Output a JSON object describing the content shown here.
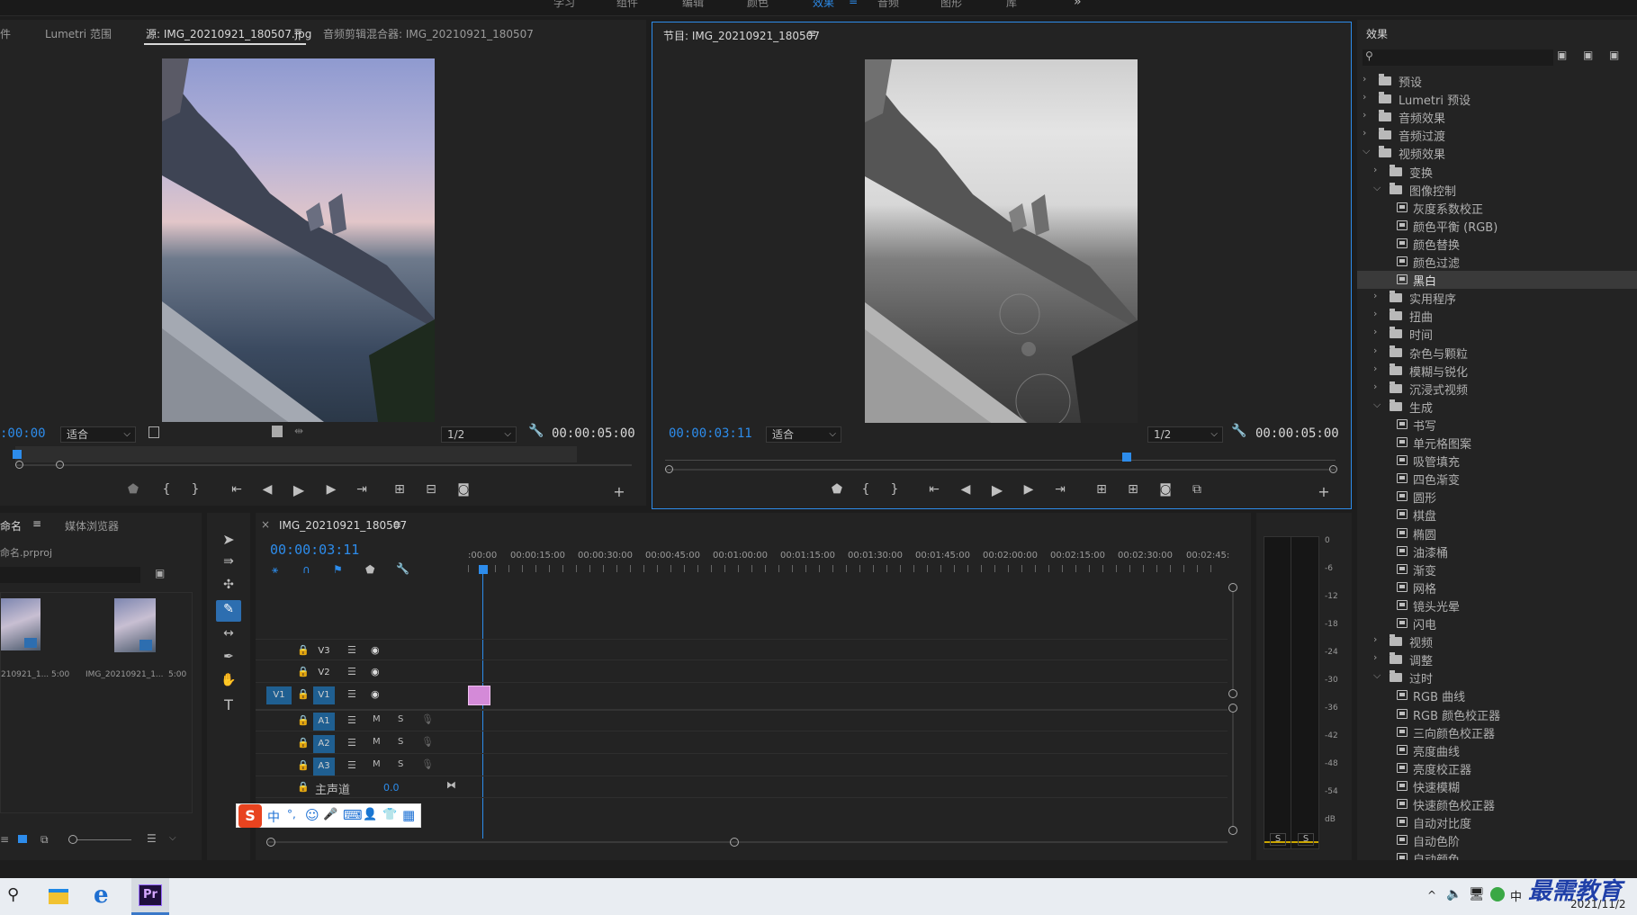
{
  "top_menu": {
    "items": [
      "学习",
      "组件",
      "编辑",
      "颜色",
      "效果",
      "音频",
      "图形",
      "库"
    ],
    "more": "»"
  },
  "source_panel": {
    "tabs": [
      "件",
      "Lumetri 范围",
      "源: IMG_20210921_180507.jpg",
      "音频剪辑混合器: IMG_20210921_180507"
    ],
    "tab_menu_icon": "≡",
    "timecode_left": ":00:00",
    "fit_label": "适合",
    "resolution": "1/2",
    "duration": "00:00:05:00"
  },
  "program_panel": {
    "tab": "节目: IMG_20210921_180507",
    "tab_menu_icon": "≡",
    "timecode_left": "00:00:03:11",
    "fit_label": "适合",
    "resolution": "1/2",
    "duration": "00:00:05:00"
  },
  "project_panel": {
    "tabs": [
      "命名",
      "媒体浏览器"
    ],
    "tab_menu_icon": "≡",
    "project_file": "命名.prproj",
    "items": [
      {
        "name": "210921_1...",
        "duration": "5:00"
      },
      {
        "name": "IMG_20210921_1...",
        "duration": "5:00"
      }
    ]
  },
  "timeline": {
    "close": "×",
    "sequence_name": "IMG_20210921_180507",
    "menu_icon": "≡",
    "timecode": "00:00:03:11",
    "ruler_labels": [
      ":00:00",
      "00:00:15:00",
      "00:00:30:00",
      "00:00:45:00",
      "00:01:00:00",
      "00:01:15:00",
      "00:01:30:00",
      "00:01:45:00",
      "00:02:00:00",
      "00:02:15:00",
      "00:02:30:00",
      "00:02:45:"
    ],
    "video_tracks": [
      "V3",
      "V2",
      "V1"
    ],
    "source_patch": "V1",
    "audio_tracks": [
      "A1",
      "A2",
      "A3"
    ],
    "mute_label": "M",
    "solo_label": "S",
    "master_label": "主声道",
    "master_value": "0.0"
  },
  "audio_meter": {
    "scale": [
      "0",
      "-6",
      "-12",
      "-18",
      "-24",
      "-30",
      "-36",
      "-42",
      "-48",
      "-54",
      "dB"
    ],
    "solo_buttons": [
      "S",
      "S"
    ]
  },
  "effects_panel": {
    "title": "效果",
    "search_placeholder": "",
    "tree": [
      {
        "level": 0,
        "type": "folder",
        "open": false,
        "label": "预设"
      },
      {
        "level": 0,
        "type": "folder",
        "open": false,
        "label": "Lumetri 预设"
      },
      {
        "level": 0,
        "type": "folder",
        "open": false,
        "label": "音频效果"
      },
      {
        "level": 0,
        "type": "folder",
        "open": false,
        "label": "音频过渡"
      },
      {
        "level": 0,
        "type": "folder",
        "open": true,
        "label": "视频效果"
      },
      {
        "level": 1,
        "type": "folder",
        "open": false,
        "label": "变换"
      },
      {
        "level": 1,
        "type": "folder",
        "open": true,
        "label": "图像控制"
      },
      {
        "level": 2,
        "type": "fx",
        "label": "灰度系数校正"
      },
      {
        "level": 2,
        "type": "fx",
        "label": "颜色平衡 (RGB)"
      },
      {
        "level": 2,
        "type": "fx",
        "label": "颜色替换"
      },
      {
        "level": 2,
        "type": "fx",
        "label": "颜色过滤"
      },
      {
        "level": 2,
        "type": "fx",
        "label": "黑白",
        "selected": true
      },
      {
        "level": 1,
        "type": "folder",
        "open": false,
        "label": "实用程序"
      },
      {
        "level": 1,
        "type": "folder",
        "open": false,
        "label": "扭曲"
      },
      {
        "level": 1,
        "type": "folder",
        "open": false,
        "label": "时间"
      },
      {
        "level": 1,
        "type": "folder",
        "open": false,
        "label": "杂色与颗粒"
      },
      {
        "level": 1,
        "type": "folder",
        "open": false,
        "label": "模糊与锐化"
      },
      {
        "level": 1,
        "type": "folder",
        "open": false,
        "label": "沉浸式视频"
      },
      {
        "level": 1,
        "type": "folder",
        "open": true,
        "label": "生成"
      },
      {
        "level": 2,
        "type": "fx",
        "label": "书写"
      },
      {
        "level": 2,
        "type": "fx",
        "label": "单元格图案"
      },
      {
        "level": 2,
        "type": "fx",
        "label": "吸管填充"
      },
      {
        "level": 2,
        "type": "fx",
        "label": "四色渐变"
      },
      {
        "level": 2,
        "type": "fx",
        "label": "圆形"
      },
      {
        "level": 2,
        "type": "fx",
        "label": "棋盘"
      },
      {
        "level": 2,
        "type": "fx",
        "label": "椭圆"
      },
      {
        "level": 2,
        "type": "fx",
        "label": "油漆桶"
      },
      {
        "level": 2,
        "type": "fx",
        "label": "渐变"
      },
      {
        "level": 2,
        "type": "fx",
        "label": "网格"
      },
      {
        "level": 2,
        "type": "fx",
        "label": "镜头光晕"
      },
      {
        "level": 2,
        "type": "fx",
        "label": "闪电"
      },
      {
        "level": 1,
        "type": "folder",
        "open": false,
        "label": "视频"
      },
      {
        "level": 1,
        "type": "folder",
        "open": false,
        "label": "调整"
      },
      {
        "level": 1,
        "type": "folder",
        "open": true,
        "label": "过时"
      },
      {
        "level": 2,
        "type": "fx",
        "label": "RGB 曲线"
      },
      {
        "level": 2,
        "type": "fx",
        "label": "RGB 颜色校正器"
      },
      {
        "level": 2,
        "type": "fx",
        "label": "三向颜色校正器"
      },
      {
        "level": 2,
        "type": "fx",
        "label": "亮度曲线"
      },
      {
        "level": 2,
        "type": "fx",
        "label": "亮度校正器"
      },
      {
        "level": 2,
        "type": "fx",
        "label": "快速模糊"
      },
      {
        "level": 2,
        "type": "fx",
        "label": "快速颜色校正器"
      },
      {
        "level": 2,
        "type": "fx",
        "label": "自动对比度"
      },
      {
        "level": 2,
        "type": "fx",
        "label": "自动色阶"
      },
      {
        "level": 2,
        "type": "fx",
        "label": "自动颜色"
      }
    ]
  },
  "ime_toolbar": {
    "logo": "S",
    "items": [
      "中",
      "°,",
      "☺",
      "🎤",
      "⌨",
      "👤",
      "👕",
      "▦"
    ]
  },
  "taskbar": {
    "premiere_label": "Pr",
    "date": "2021/11/2",
    "watermark": "最需教育"
  },
  "colors": {
    "accent_blue": "#2d8ceb",
    "selected_row": "#3a3a3a",
    "track_blue": "#1f5f91",
    "clip_pink": "#d48ad8"
  }
}
